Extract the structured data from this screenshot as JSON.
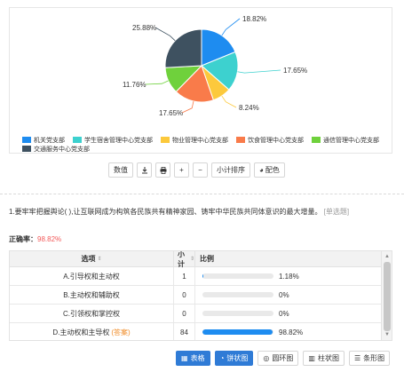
{
  "chart_data": {
    "type": "pie",
    "slices": [
      {
        "name": "机关党支部",
        "value": 18.82,
        "color": "#1e8cf0"
      },
      {
        "name": "学生宿舍管理中心党支部",
        "value": 17.65,
        "color": "#3dd1cf"
      },
      {
        "name": "物业管理中心党支部",
        "value": 8.24,
        "color": "#fcc93c"
      },
      {
        "name": "饮食管理中心党支部",
        "value": 17.65,
        "color": "#f97b4a"
      },
      {
        "name": "通信管理中心党支部",
        "value": 11.76,
        "color": "#6fd13c"
      },
      {
        "name": "交通服务中心党支部",
        "value": 25.88,
        "color": "#3e5160"
      }
    ],
    "labels": [
      "18.82%",
      "17.65%",
      "8.24%",
      "17.65%",
      "11.76%",
      "25.88%"
    ]
  },
  "toolbar": {
    "value_btn": "数值",
    "download_icon": "download-icon",
    "print_icon": "print-icon",
    "plus": "+",
    "minus": "−",
    "sort_btn": "小计排序",
    "color_btn": "配色",
    "color_icon": "palette-icon"
  },
  "question": {
    "text": "1.要牢牢把握舆论(   ),让互联网成为构筑各民族共有精神家园、铸牢中华民族共同体意识的最大增量。",
    "tag": "[单选题]"
  },
  "accuracy": {
    "label": "正确率：",
    "value": "98.82%"
  },
  "table": {
    "headers": {
      "option": "选项",
      "count": "小计",
      "ratio": "比例"
    },
    "rows": [
      {
        "option": "A.引导权和主动权",
        "count": "1",
        "percent": "1.18%",
        "fill": 1.18,
        "answer": ""
      },
      {
        "option": "B.主动权和辅助权",
        "count": "0",
        "percent": "0%",
        "fill": 0,
        "answer": ""
      },
      {
        "option": "C.引领权和掌控权",
        "count": "0",
        "percent": "0%",
        "fill": 0,
        "answer": ""
      },
      {
        "option": "D.主动权和主导权",
        "count": "84",
        "percent": "98.82%",
        "fill": 98.82,
        "answer": "(答案)"
      }
    ]
  },
  "views": {
    "table": "表格",
    "pie": "饼状图",
    "ring": "圆环图",
    "column": "柱状图",
    "bar": "条形图"
  }
}
